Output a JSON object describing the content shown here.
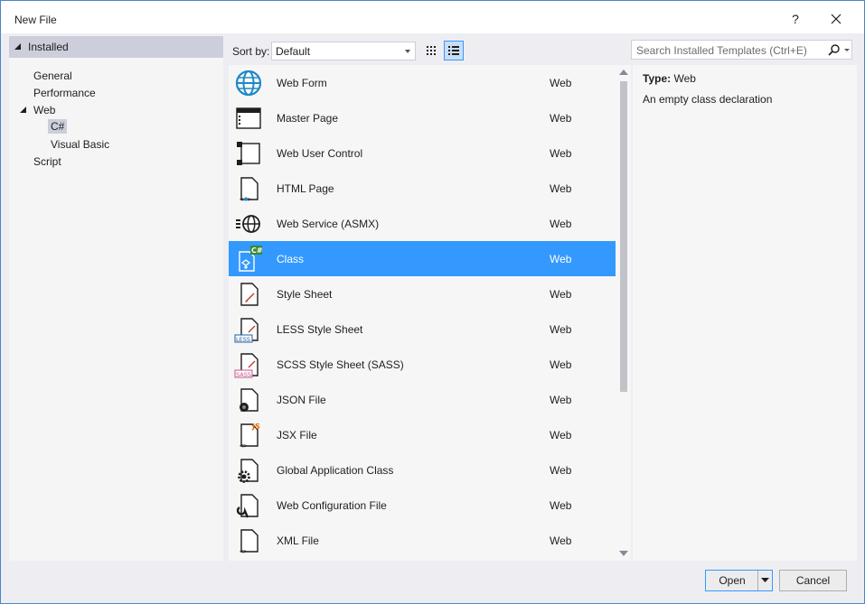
{
  "window": {
    "title": "New File",
    "help": "?"
  },
  "tree": {
    "root": "Installed",
    "items": [
      "General",
      "Performance",
      "Web",
      "C#",
      "Visual Basic",
      "Script"
    ]
  },
  "toolbar": {
    "sort_label": "Sort by:",
    "sort_value": "Default",
    "search_placeholder": "Search Installed Templates (Ctrl+E)"
  },
  "templates": [
    {
      "name": "Web Form",
      "type": "Web",
      "icon": "globe-icon"
    },
    {
      "name": "Master Page",
      "type": "Web",
      "icon": "master-page-icon"
    },
    {
      "name": "Web User Control",
      "type": "Web",
      "icon": "user-control-icon"
    },
    {
      "name": "HTML Page",
      "type": "Web",
      "icon": "html-page-icon"
    },
    {
      "name": "Web Service (ASMX)",
      "type": "Web",
      "icon": "web-service-icon"
    },
    {
      "name": "Class",
      "type": "Web",
      "icon": "csharp-class-icon",
      "selected": true
    },
    {
      "name": "Style Sheet",
      "type": "Web",
      "icon": "style-sheet-icon"
    },
    {
      "name": "LESS Style Sheet",
      "type": "Web",
      "icon": "less-icon",
      "badge": "LESS"
    },
    {
      "name": "SCSS Style Sheet (SASS)",
      "type": "Web",
      "icon": "sass-icon",
      "badge": "SASS"
    },
    {
      "name": "JSON File",
      "type": "Web",
      "icon": "json-icon"
    },
    {
      "name": "JSX File",
      "type": "Web",
      "icon": "jsx-icon",
      "badge": "JS"
    },
    {
      "name": "Global Application Class",
      "type": "Web",
      "icon": "gear-page-icon"
    },
    {
      "name": "Web Configuration File",
      "type": "Web",
      "icon": "wrench-page-icon"
    },
    {
      "name": "XML File",
      "type": "Web",
      "icon": "xml-icon"
    }
  ],
  "details": {
    "type_label": "Type:",
    "type_value": "Web",
    "description": "An empty class declaration"
  },
  "buttons": {
    "open": "Open",
    "cancel": "Cancel"
  },
  "colors": {
    "accent": "#3399ff",
    "selected_tree": "#cccedb",
    "border": "#4a86c8"
  }
}
